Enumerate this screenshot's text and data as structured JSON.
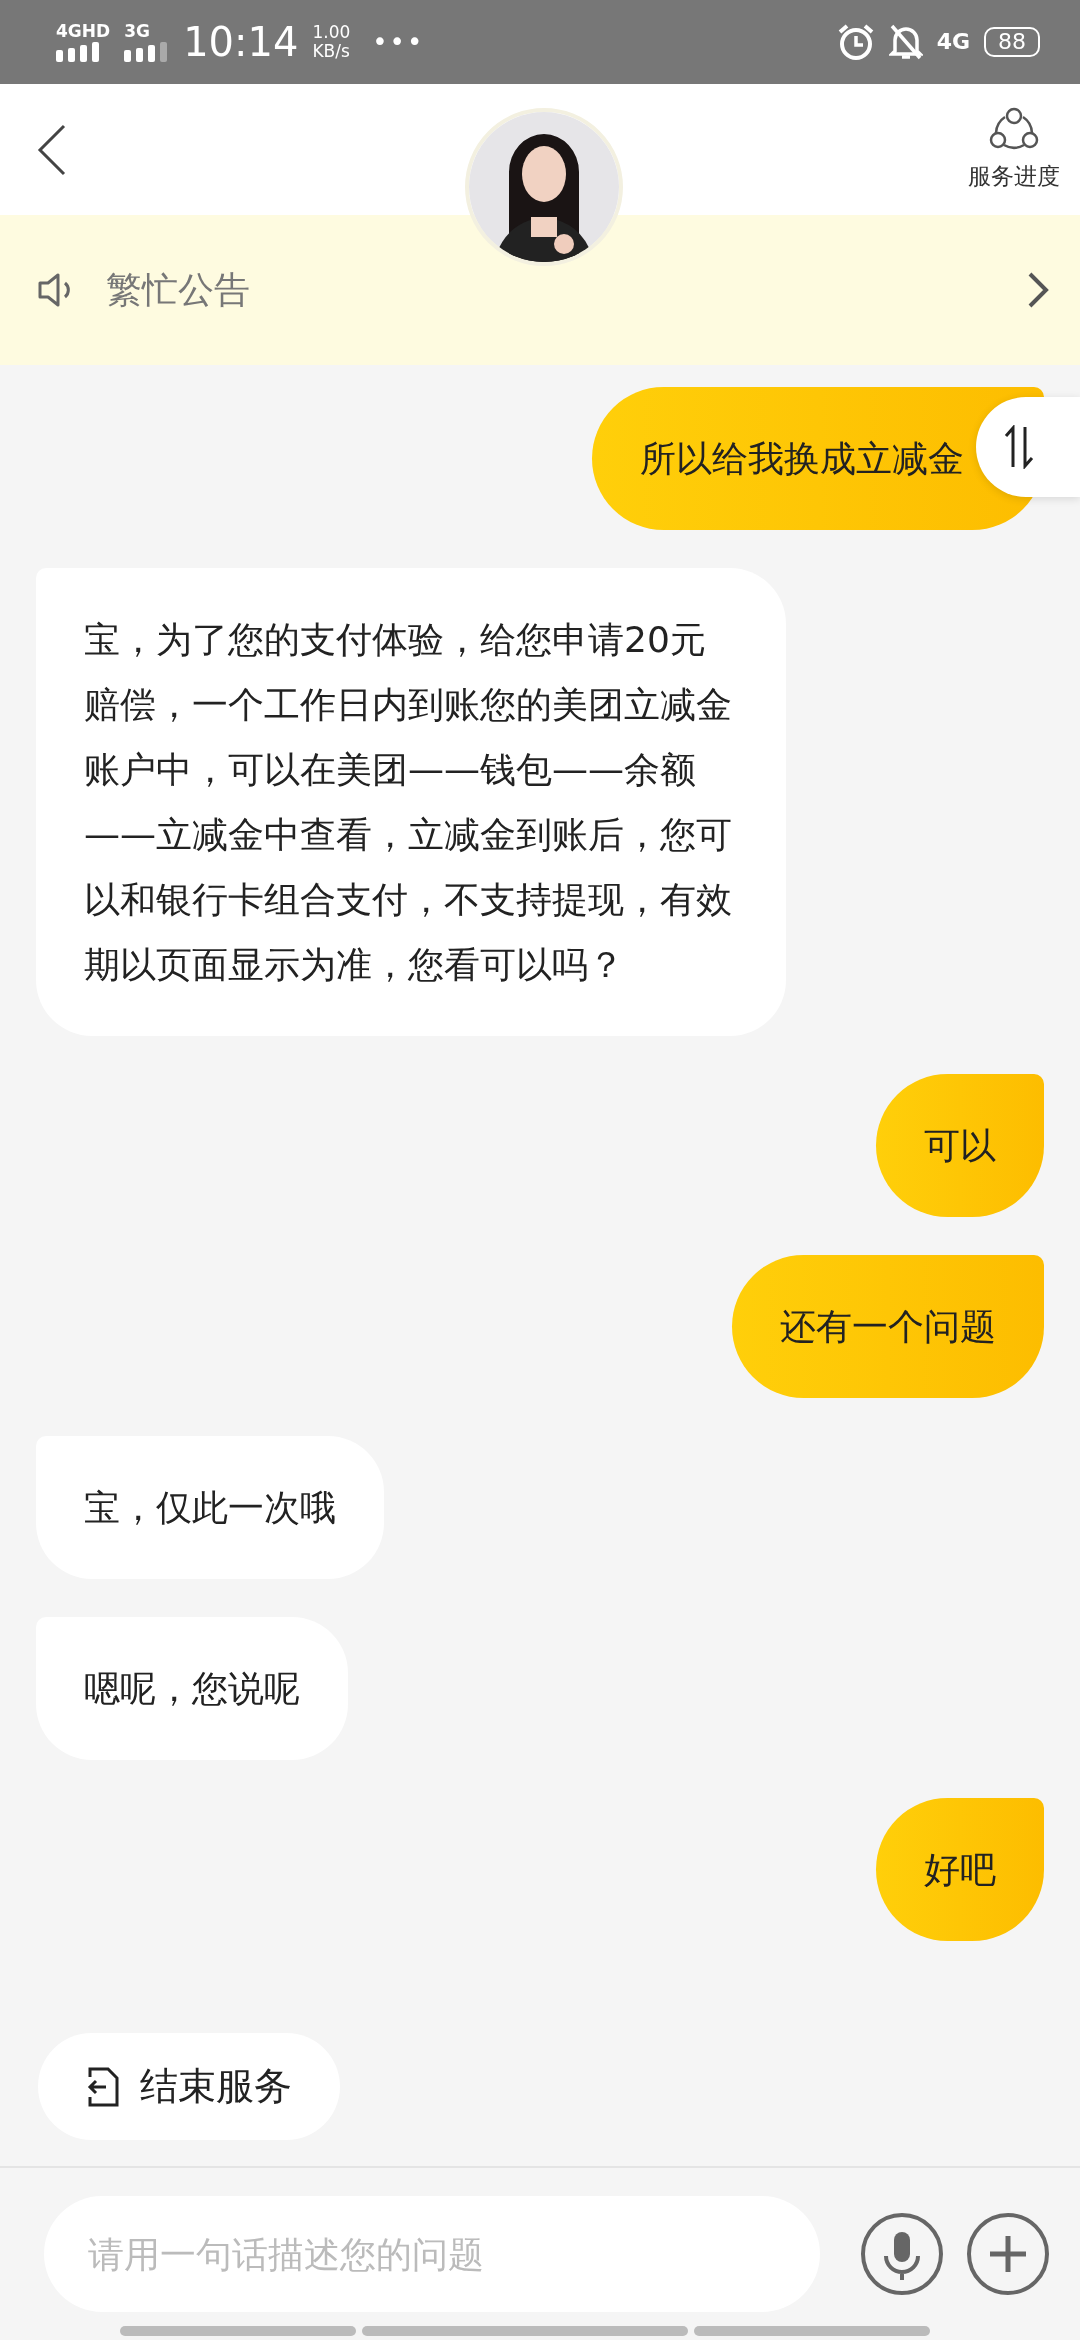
{
  "status_bar": {
    "network_1": "4GHD",
    "network_2": "3G",
    "time": "10:14",
    "speed_value": "1.00",
    "speed_unit": "KB/s",
    "more": "•••",
    "network_3": "4G",
    "battery": "88"
  },
  "header": {
    "progress_label": "服务进度"
  },
  "notice": {
    "text": "繁忙公告"
  },
  "messages": [
    {
      "kind": "user",
      "text": "所以给我换成立减金"
    },
    {
      "kind": "agent",
      "text": "宝，为了您的支付体验，给您申请20元赔偿，一个工作日内到账您的美团立减金账户中，可以在美团——钱包——余额——立减金中查看，立减金到账后，您可以和银行卡组合支付，不支持提现，有效期以页面显示为准，您看可以吗？"
    },
    {
      "kind": "user",
      "text": "可以"
    },
    {
      "kind": "user",
      "text": "还有一个问题"
    },
    {
      "kind": "agent",
      "text": "宝，仅此一次哦"
    },
    {
      "kind": "agent",
      "text": "嗯呢，您说呢"
    },
    {
      "kind": "user",
      "text": "好吧"
    }
  ],
  "end_service": {
    "label": "结束服务"
  },
  "input": {
    "placeholder": "请用一句话描述您的问题"
  }
}
